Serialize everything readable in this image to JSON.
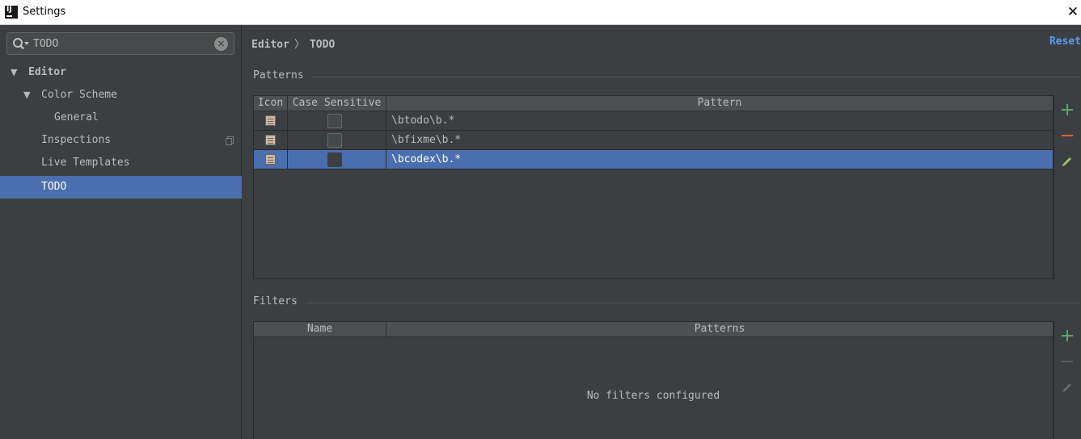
{
  "window": {
    "title": "Settings",
    "close_glyph": "✕",
    "logo_text": "IJ"
  },
  "search": {
    "value": "TODO",
    "clear_glyph": "×"
  },
  "tree": [
    {
      "label": "Editor",
      "arrow": "▼"
    },
    {
      "label": "Color Scheme",
      "arrow": "▼"
    },
    {
      "label": "General"
    },
    {
      "label": "Inspections"
    },
    {
      "label": "Live Templates"
    },
    {
      "label": "TODO"
    }
  ],
  "breadcrumb": {
    "parent": "Editor",
    "separator": "〉",
    "current": "TODO"
  },
  "reset_label": "Reset",
  "patterns": {
    "title": "Patterns",
    "columns": [
      "Icon",
      "Case Sensitive",
      "Pattern"
    ],
    "rows": [
      {
        "pattern": "\\btodo\\b.*",
        "case_sensitive": false,
        "selected": false
      },
      {
        "pattern": "\\bfixme\\b.*",
        "case_sensitive": false,
        "selected": false
      },
      {
        "pattern": "\\bcodex\\b.*",
        "case_sensitive": false,
        "selected": true
      }
    ]
  },
  "filters": {
    "title": "Filters",
    "columns": [
      "Name",
      "Patterns"
    ],
    "empty_text": "No filters configured"
  },
  "colors": {
    "accent_selected": "#4b6eaf",
    "add": "#59a869",
    "remove": "#e05c3c",
    "edit": "#9ac46a",
    "link": "#589df6"
  }
}
